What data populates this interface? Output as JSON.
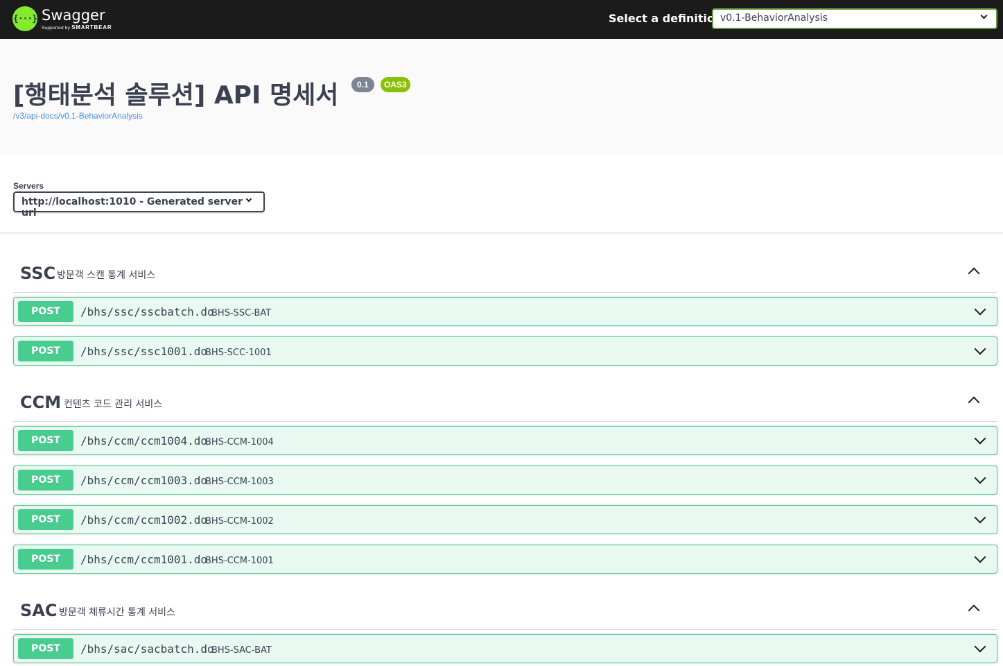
{
  "topbar": {
    "logo_text": "Swagger",
    "logo_sub_prefix": "Supported by",
    "logo_sub_brand": "SMARTBEAR",
    "definition_label": "Select a definition",
    "definition_value": "v0.1-BehaviorAnalysis"
  },
  "info": {
    "title": "[행태분석 솔루션] API 명세서",
    "version": "0.1",
    "oas": "OAS3",
    "link": "/v3/api-docs/v0.1-BehaviorAnalysis"
  },
  "servers": {
    "label": "Servers",
    "selected": "http://localhost:1010 - Generated server url"
  },
  "tags": [
    {
      "name": "SSC",
      "description": "방문객 스캔 통계 서비스",
      "operations": [
        {
          "method": "POST",
          "path": "/bhs/ssc/sscbatch.do",
          "summary": "BHS-SSC-BAT"
        },
        {
          "method": "POST",
          "path": "/bhs/ssc/ssc1001.do",
          "summary": "BHS-SCC-1001"
        }
      ]
    },
    {
      "name": "CCM",
      "description": "컨텐츠 코드 관리 서비스",
      "operations": [
        {
          "method": "POST",
          "path": "/bhs/ccm/ccm1004.do",
          "summary": "BHS-CCM-1004"
        },
        {
          "method": "POST",
          "path": "/bhs/ccm/ccm1003.do",
          "summary": "BHS-CCM-1003"
        },
        {
          "method": "POST",
          "path": "/bhs/ccm/ccm1002.do",
          "summary": "BHS-CCM-1002"
        },
        {
          "method": "POST",
          "path": "/bhs/ccm/ccm1001.do",
          "summary": "BHS-CCM-1001"
        }
      ]
    },
    {
      "name": "SAC",
      "description": "방문객 체류시간 통계 서비스",
      "operations": [
        {
          "method": "POST",
          "path": "/bhs/sac/sacbatch.do",
          "summary": "BHS-SAC-BAT"
        }
      ]
    }
  ],
  "colors": {
    "topbar_bg": "#1b1b1b",
    "post": "#49cc90",
    "version_badge": "#7d8492",
    "oas_badge": "#89bf04",
    "link": "#4990e2"
  }
}
